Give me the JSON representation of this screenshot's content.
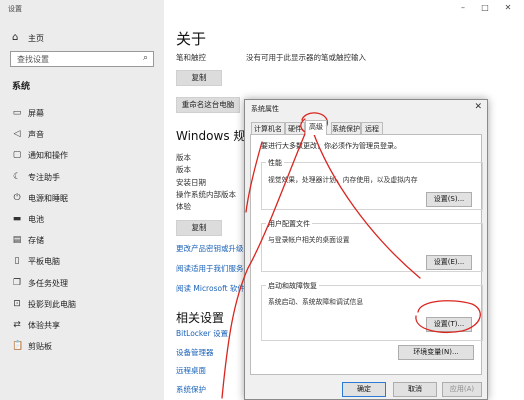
{
  "window": {
    "title": "设置",
    "minimize": "–",
    "maximize": "□",
    "close": "✕"
  },
  "sidebar": {
    "home": "主页",
    "search_placeholder": "查找设置",
    "section": "系统",
    "items": [
      {
        "label": "屏幕",
        "icon": "monitor-icon"
      },
      {
        "label": "声音",
        "icon": "speaker-icon"
      },
      {
        "label": "通知和操作",
        "icon": "notification-icon"
      },
      {
        "label": "专注助手",
        "icon": "moon-icon"
      },
      {
        "label": "电源和睡眠",
        "icon": "power-icon"
      },
      {
        "label": "电池",
        "icon": "battery-icon"
      },
      {
        "label": "存储",
        "icon": "storage-icon"
      },
      {
        "label": "平板电脑",
        "icon": "tablet-icon"
      },
      {
        "label": "多任务处理",
        "icon": "multitask-icon"
      },
      {
        "label": "投影到此电脑",
        "icon": "project-icon"
      },
      {
        "label": "体验共享",
        "icon": "share-icon"
      },
      {
        "label": "剪贴板",
        "icon": "clipboard-icon"
      }
    ]
  },
  "main": {
    "title": "关于",
    "pen_touch_label": "笔和触控",
    "pen_touch_value": "没有可用于此显示器的笔或触控输入",
    "copy_button": "复制",
    "rename_button": "重命名这台电脑",
    "windows_spec_title": "Windows 规格",
    "spec_rows": [
      "版本",
      "版本",
      "安装日期",
      "操作系统内部版本",
      "体验"
    ],
    "copy_button_2": "复制",
    "links": [
      "更改产品密钥或升级",
      "阅读适用于我们服务的",
      "阅读 Microsoft 软件许可"
    ],
    "related_title": "相关设置",
    "related_links": [
      "BitLocker 设置",
      "设备管理器",
      "远程桌面",
      "系统保护"
    ]
  },
  "dialog": {
    "title": "系统属性",
    "close": "✕",
    "tabs": [
      "计算机名",
      "硬件",
      "高级",
      "系统保护",
      "远程"
    ],
    "active_tab": "高级",
    "admin_note": "要进行大多数更改，你必须作为管理员登录。",
    "groups": [
      {
        "title": "性能",
        "desc": "视觉效果，处理器计划，内存使用，以及虚拟内存",
        "button": "设置(S)..."
      },
      {
        "title": "用户配置文件",
        "desc": "与登录帐户相关的桌面设置",
        "button": "设置(E)..."
      },
      {
        "title": "启动和故障恢复",
        "desc": "系统启动、系统故障和调试信息",
        "button": "设置(T)..."
      }
    ],
    "env_button": "环境变量(N)...",
    "ok": "确定",
    "cancel": "取消",
    "apply": "应用(A)"
  },
  "colors": {
    "annotation": "#d8261f",
    "link": "#1a62b8",
    "accent": "#2d7ad6"
  }
}
